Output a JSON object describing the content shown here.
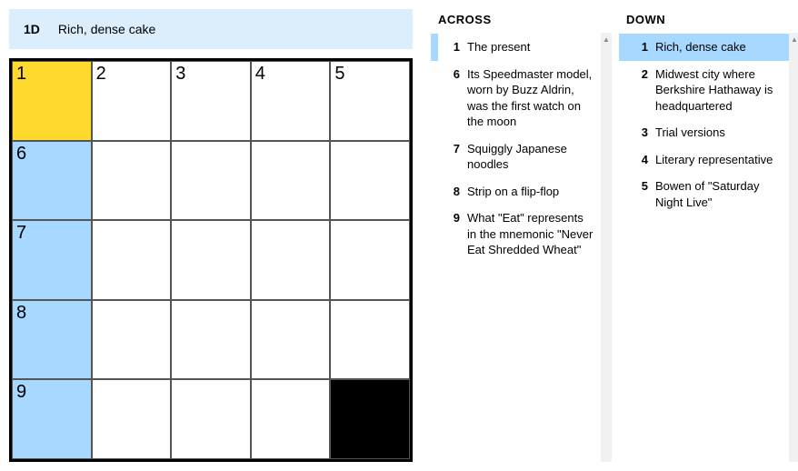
{
  "clue_bar": {
    "id": "1D",
    "text": "Rich, dense cake"
  },
  "grid": {
    "size": 5,
    "cells": [
      {
        "r": 0,
        "c": 0,
        "num": "1",
        "state": "yellow"
      },
      {
        "r": 0,
        "c": 1,
        "num": "2",
        "state": ""
      },
      {
        "r": 0,
        "c": 2,
        "num": "3",
        "state": ""
      },
      {
        "r": 0,
        "c": 3,
        "num": "4",
        "state": ""
      },
      {
        "r": 0,
        "c": 4,
        "num": "5",
        "state": ""
      },
      {
        "r": 1,
        "c": 0,
        "num": "6",
        "state": "blue"
      },
      {
        "r": 1,
        "c": 1,
        "num": "",
        "state": ""
      },
      {
        "r": 1,
        "c": 2,
        "num": "",
        "state": ""
      },
      {
        "r": 1,
        "c": 3,
        "num": "",
        "state": ""
      },
      {
        "r": 1,
        "c": 4,
        "num": "",
        "state": ""
      },
      {
        "r": 2,
        "c": 0,
        "num": "7",
        "state": "blue"
      },
      {
        "r": 2,
        "c": 1,
        "num": "",
        "state": ""
      },
      {
        "r": 2,
        "c": 2,
        "num": "",
        "state": ""
      },
      {
        "r": 2,
        "c": 3,
        "num": "",
        "state": ""
      },
      {
        "r": 2,
        "c": 4,
        "num": "",
        "state": ""
      },
      {
        "r": 3,
        "c": 0,
        "num": "8",
        "state": "blue"
      },
      {
        "r": 3,
        "c": 1,
        "num": "",
        "state": ""
      },
      {
        "r": 3,
        "c": 2,
        "num": "",
        "state": ""
      },
      {
        "r": 3,
        "c": 3,
        "num": "",
        "state": ""
      },
      {
        "r": 3,
        "c": 4,
        "num": "",
        "state": ""
      },
      {
        "r": 4,
        "c": 0,
        "num": "9",
        "state": "blue"
      },
      {
        "r": 4,
        "c": 1,
        "num": "",
        "state": ""
      },
      {
        "r": 4,
        "c": 2,
        "num": "",
        "state": ""
      },
      {
        "r": 4,
        "c": 3,
        "num": "",
        "state": ""
      },
      {
        "r": 4,
        "c": 4,
        "num": "",
        "state": "black"
      }
    ]
  },
  "across": {
    "title": "ACROSS",
    "clues": [
      {
        "n": "1",
        "t": "The present",
        "hl": "blue"
      },
      {
        "n": "6",
        "t": "Its Speedmaster model, worn by Buzz Aldrin, was the first watch on the moon",
        "hl": ""
      },
      {
        "n": "7",
        "t": "Squiggly Japanese noodles",
        "hl": ""
      },
      {
        "n": "8",
        "t": "Strip on a flip-flop",
        "hl": ""
      },
      {
        "n": "9",
        "t": "What \"Eat\" represents in the mnemonic \"Never Eat Shredded Wheat\"",
        "hl": ""
      }
    ]
  },
  "down": {
    "title": "DOWN",
    "clues": [
      {
        "n": "1",
        "t": "Rich, dense cake",
        "hl": "sel"
      },
      {
        "n": "2",
        "t": "Midwest city where Berkshire Hathaway is headquartered",
        "hl": ""
      },
      {
        "n": "3",
        "t": "Trial versions",
        "hl": ""
      },
      {
        "n": "4",
        "t": "Literary representative",
        "hl": ""
      },
      {
        "n": "5",
        "t": "Bowen of \"Saturday Night Live\"",
        "hl": ""
      }
    ]
  }
}
